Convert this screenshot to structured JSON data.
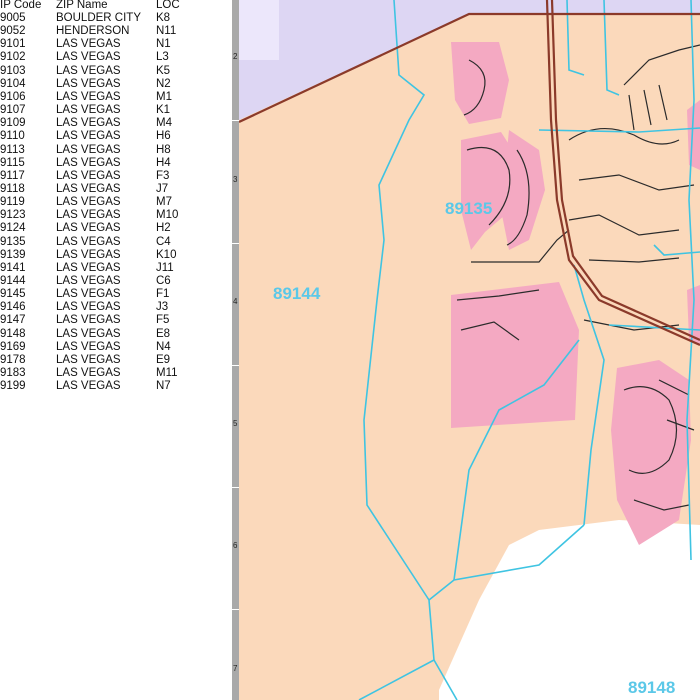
{
  "zip_index": {
    "headers": [
      "IP Code",
      "ZIP Name",
      "LOC"
    ],
    "rows": [
      [
        "9005",
        "BOULDER CITY",
        "K8"
      ],
      [
        "9052",
        "HENDERSON",
        "N11"
      ],
      [
        "9101",
        "LAS VEGAS",
        "N1"
      ],
      [
        "9102",
        "LAS VEGAS",
        "L3"
      ],
      [
        "9103",
        "LAS VEGAS",
        "K5"
      ],
      [
        "9104",
        "LAS VEGAS",
        "N2"
      ],
      [
        "9106",
        "LAS VEGAS",
        "M1"
      ],
      [
        "9107",
        "LAS VEGAS",
        "K1"
      ],
      [
        "9109",
        "LAS VEGAS",
        "M4"
      ],
      [
        "9110",
        "LAS VEGAS",
        "H6"
      ],
      [
        "9113",
        "LAS VEGAS",
        "H8"
      ],
      [
        "9115",
        "LAS VEGAS",
        "H4"
      ],
      [
        "9117",
        "LAS VEGAS",
        "F3"
      ],
      [
        "9118",
        "LAS VEGAS",
        "J7"
      ],
      [
        "9119",
        "LAS VEGAS",
        "M7"
      ],
      [
        "9123",
        "LAS VEGAS",
        "M10"
      ],
      [
        "9124",
        "LAS VEGAS",
        "H2"
      ],
      [
        "9135",
        "LAS VEGAS",
        "C4"
      ],
      [
        "9139",
        "LAS VEGAS",
        "K10"
      ],
      [
        "9141",
        "LAS VEGAS",
        "J11"
      ],
      [
        "9144",
        "LAS VEGAS",
        "C6"
      ],
      [
        "9145",
        "LAS VEGAS",
        "F1"
      ],
      [
        "9146",
        "LAS VEGAS",
        "J3"
      ],
      [
        "9147",
        "LAS VEGAS",
        "F5"
      ],
      [
        "9148",
        "LAS VEGAS",
        "E8"
      ],
      [
        "9169",
        "LAS VEGAS",
        "N4"
      ],
      [
        "9178",
        "LAS VEGAS",
        "E9"
      ],
      [
        "9183",
        "LAS VEGAS",
        "M11"
      ],
      [
        "9199",
        "LAS VEGAS",
        "N7"
      ]
    ]
  },
  "grid_rows": [
    "2",
    "3",
    "4",
    "5",
    "6",
    "7"
  ],
  "zip_labels": {
    "z89144": "89144",
    "z89135": "89135",
    "z89148": "89148"
  },
  "colors": {
    "zip_fill": "#fbd9bb",
    "north_fill": "#ddd6f3",
    "residential": "#f4a9c2",
    "boundary": "#3fc4e2",
    "highway": "#8b3a2a",
    "label": "#5bc8e8",
    "ruler": "#a9a9a9"
  }
}
